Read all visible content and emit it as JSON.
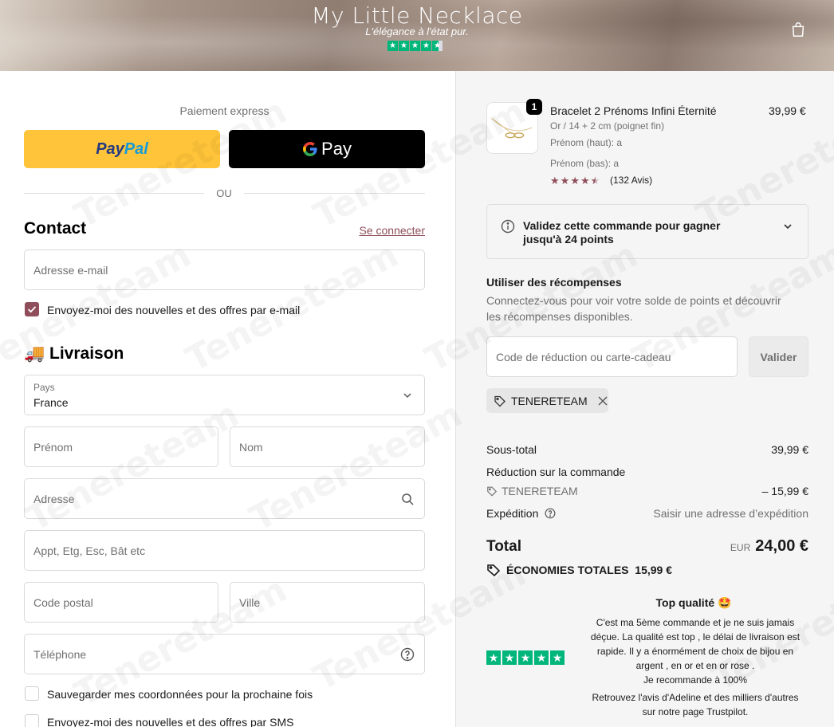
{
  "header": {
    "title": "My Little Necklace",
    "tagline": "L'élégance à l'état pur.",
    "cart_icon": "shopping-bag-icon"
  },
  "express": {
    "label": "Paiement express",
    "paypal": [
      "Pay",
      "Pal"
    ],
    "gpay": "Pay",
    "or": "OU"
  },
  "contact": {
    "title": "Contact",
    "login": "Se connecter",
    "email_placeholder": "Adresse e-mail",
    "newsletter": "Envoyez-moi des nouvelles et des offres par e-mail",
    "newsletter_checked": true
  },
  "delivery": {
    "title": "Livraison",
    "title_icon": "🚚",
    "country_label": "Pays",
    "country": "France",
    "first_name": "Prénom",
    "last_name": "Nom",
    "address": "Adresse",
    "apartment": "Appt, Etg, Esc, Bât etc",
    "postal": "Code postal",
    "city": "Ville",
    "phone": "Téléphone",
    "save": "Sauvegarder mes coordonnées pour la prochaine fois",
    "sms": "Envoyez-moi des nouvelles et des offres par SMS"
  },
  "product": {
    "qty": "1",
    "name": "Bracelet 2 Prénoms Infini Éternité",
    "price": "39,99 €",
    "variant": "Or / 14 + 2 cm (poignet fin)",
    "opt1": "Prénom (haut): a",
    "opt2": "Prénom (bas): a",
    "rating": 4.5,
    "reviews": "(132 Avis)"
  },
  "points": {
    "line1": "Validez cette commande pour gagner",
    "line2": "jusqu'à 24 points"
  },
  "rewards": {
    "title": "Utiliser des récompenses",
    "desc1": "Connectez-vous pour voir votre solde de points et découvrir",
    "desc2": "les récompenses disponibles."
  },
  "discount": {
    "placeholder": "Code de réduction ou carte-cadeau",
    "button": "Valider",
    "code": "TENERETEAM"
  },
  "summary": {
    "subtotal_label": "Sous-total",
    "subtotal": "39,99 €",
    "reduction_label": "Réduction sur la commande",
    "reduction_code": "TENERETEAM",
    "reduction": "– 15,99 €",
    "shipping_label": "Expédition",
    "shipping": "Saisir une adresse d’expédition",
    "total_label": "Total",
    "currency": "EUR",
    "total": "24,00 €",
    "savings_label": "ÉCONOMIES TOTALES",
    "savings": "15,99 €"
  },
  "review": {
    "title": "Top qualité 🤩",
    "text1": "C'est ma 5ème commande et je ne suis jamais",
    "text2": "déçue. La qualité est top , le délai de livraison est",
    "text3": "rapide. Il y a énormément de choix de bijou en",
    "text4": "argent , en or et en or rose .",
    "text5": "Je recommande à 100%",
    "footer1": "Retrouvez l'avis d'Adeline et des milliers d'autres",
    "footer2": "sur notre page Trustpilot.",
    "stars": 5
  },
  "watermark": "Tenereteam",
  "colors": {
    "accent": "#8f4e5a",
    "paypal": "#ffc439",
    "trustpilot": "#00b67a"
  }
}
